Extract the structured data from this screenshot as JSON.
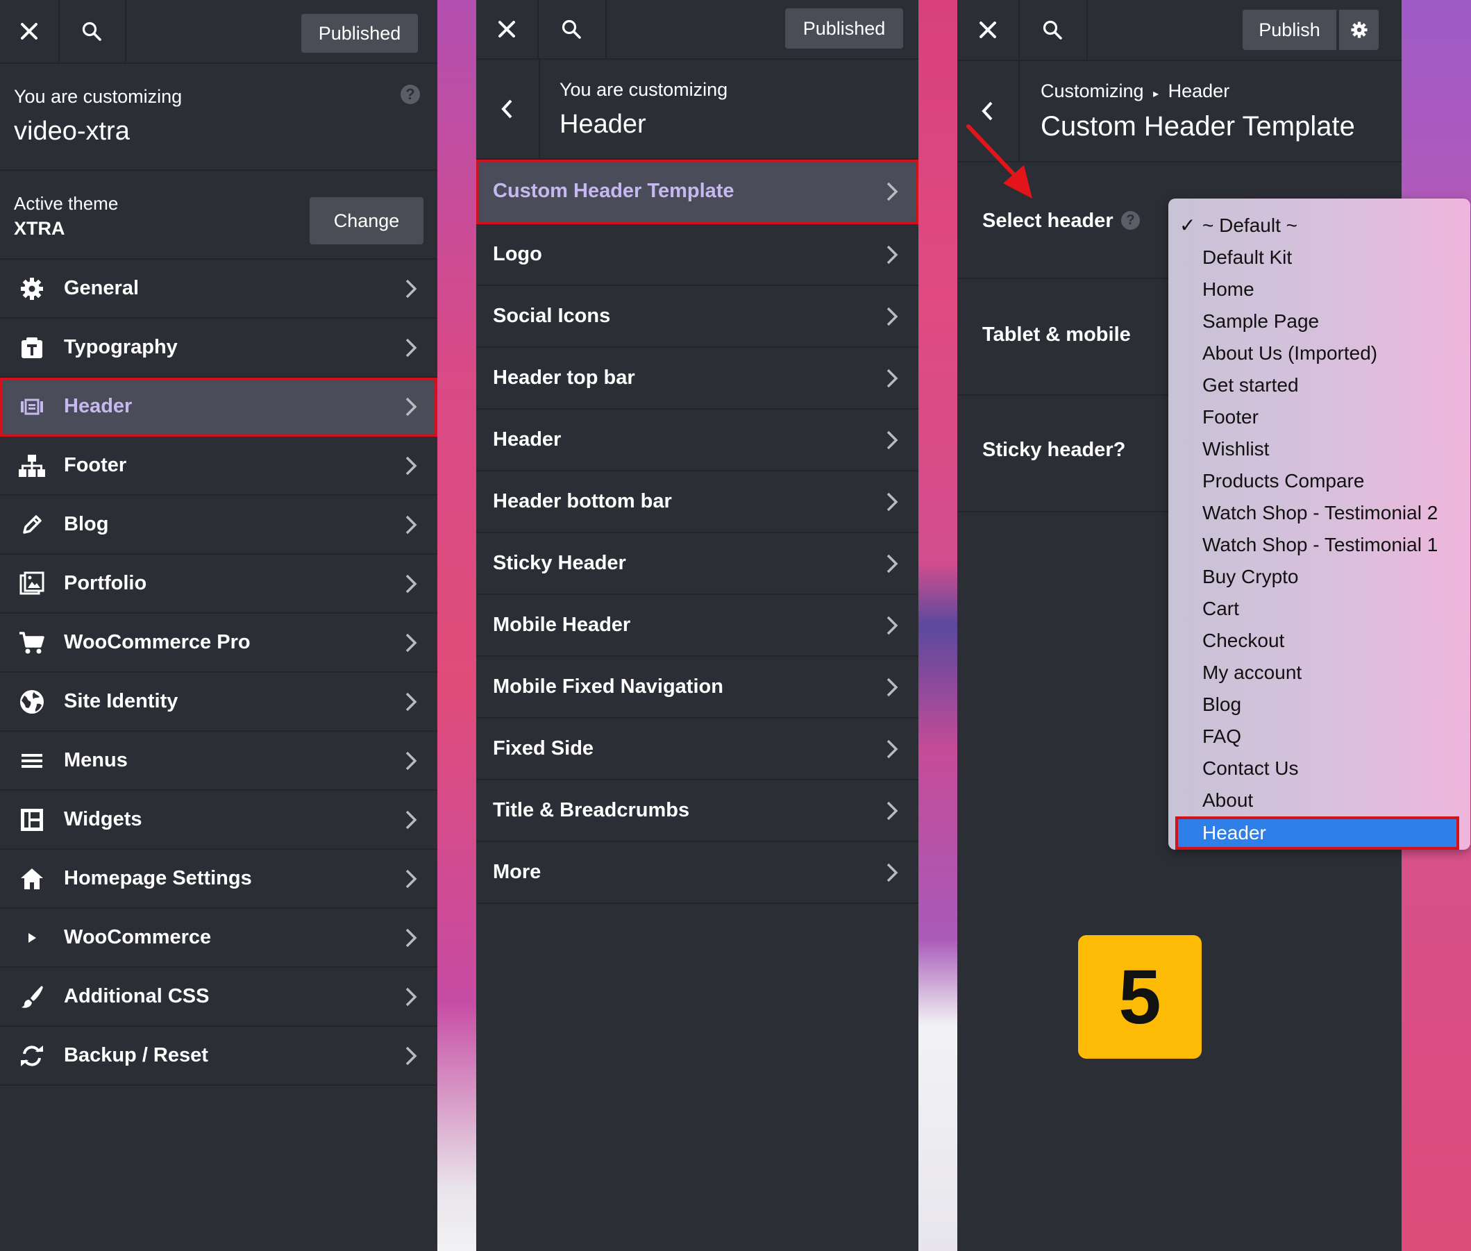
{
  "panel1": {
    "publish_label": "Published",
    "customizing_label": "You are customizing",
    "site_name": "video-xtra",
    "active_theme_label": "Active theme",
    "theme_name": "XTRA",
    "change_label": "Change",
    "items": [
      {
        "label": "General",
        "icon": "gear-icon"
      },
      {
        "label": "Typography",
        "icon": "typography-icon"
      },
      {
        "label": "Header",
        "icon": "header-icon"
      },
      {
        "label": "Footer",
        "icon": "sitemap-icon"
      },
      {
        "label": "Blog",
        "icon": "pencil-icon"
      },
      {
        "label": "Portfolio",
        "icon": "gallery-icon"
      },
      {
        "label": "WooCommerce Pro",
        "icon": "cart-icon"
      },
      {
        "label": "Site Identity",
        "icon": "globe-icon"
      },
      {
        "label": "Menus",
        "icon": "menu-icon"
      },
      {
        "label": "Widgets",
        "icon": "widgets-icon"
      },
      {
        "label": "Homepage Settings",
        "icon": "home-icon"
      },
      {
        "label": "WooCommerce",
        "icon": "play-icon"
      },
      {
        "label": "Additional CSS",
        "icon": "brush-icon"
      },
      {
        "label": "Backup / Reset",
        "icon": "refresh-icon"
      }
    ]
  },
  "panel2": {
    "publish_label": "Published",
    "customizing_label": "You are customizing",
    "section_title": "Header",
    "items": [
      {
        "label": "Custom Header Template"
      },
      {
        "label": "Logo"
      },
      {
        "label": "Social Icons"
      },
      {
        "label": "Header top bar"
      },
      {
        "label": "Header"
      },
      {
        "label": "Header bottom bar"
      },
      {
        "label": "Sticky Header"
      },
      {
        "label": "Mobile Header"
      },
      {
        "label": "Mobile Fixed Navigation"
      },
      {
        "label": "Fixed Side"
      },
      {
        "label": "Title & Breadcrumbs"
      },
      {
        "label": "More"
      }
    ]
  },
  "panel3": {
    "publish_label": "Publish",
    "breadcrumb_root": "Customizing",
    "breadcrumb_sep": "▸",
    "breadcrumb_section": "Header",
    "title": "Custom Header Template",
    "rows": [
      {
        "label": "Select header"
      },
      {
        "label": "Tablet & mobile"
      },
      {
        "label": "Sticky header?"
      }
    ],
    "dropdown": {
      "checkmark": "✓",
      "options": [
        "~ Default ~",
        "Default Kit",
        "Home",
        "Sample Page",
        "About Us (Imported)",
        "Get started",
        "Footer",
        "Wishlist",
        "Products Compare",
        "Watch Shop - Testimonial 2",
        "Watch Shop - Testimonial 1",
        "Buy Crypto",
        "Cart",
        "Checkout",
        "My account",
        "Blog",
        "FAQ",
        "Contact Us",
        "About",
        "Header"
      ],
      "checked_index": 0,
      "selected_index": 19
    }
  },
  "step_badge": "5",
  "colors": {
    "panel_bg": "#2c2e35",
    "highlight_red": "#d3111c",
    "selected_blue": "#2f7fe9",
    "badge_yellow": "#fdbb06"
  }
}
